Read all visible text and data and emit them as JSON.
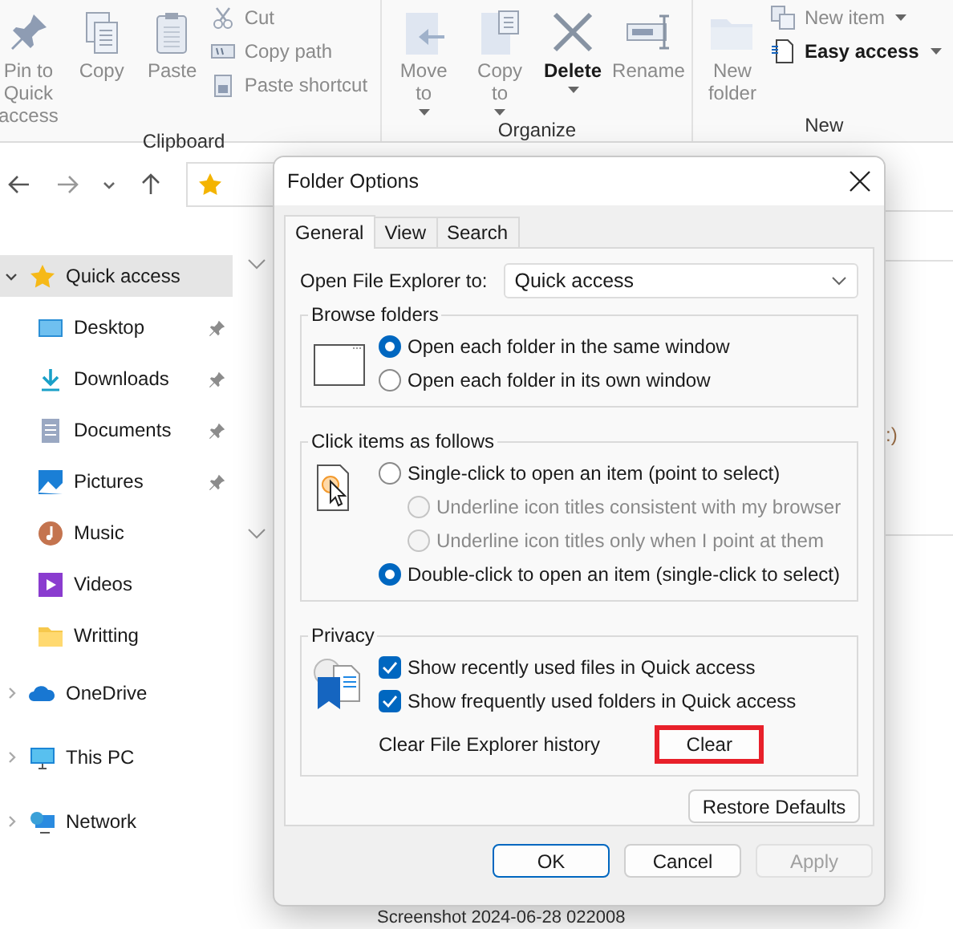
{
  "ribbon": {
    "groups": [
      {
        "label": "Clipboard",
        "items": [
          {
            "kind": "large",
            "label": "Pin to Quick access",
            "disabled": true,
            "dropdown": false
          },
          {
            "kind": "large",
            "label": "Copy",
            "disabled": true,
            "dropdown": false
          },
          {
            "kind": "large",
            "label": "Paste",
            "disabled": true,
            "dropdown": false
          },
          {
            "kind": "small",
            "label": "Cut",
            "disabled": true,
            "dropdown": false
          },
          {
            "kind": "small",
            "label": "Copy path",
            "disabled": true,
            "dropdown": false
          },
          {
            "kind": "small",
            "label": "Paste shortcut",
            "disabled": true,
            "dropdown": false
          }
        ]
      },
      {
        "label": "Organize",
        "items": [
          {
            "kind": "large",
            "label": "Move to",
            "disabled": true,
            "dropdown": true
          },
          {
            "kind": "large",
            "label": "Copy to",
            "disabled": true,
            "dropdown": true
          },
          {
            "kind": "large",
            "label": "Delete",
            "disabled": false,
            "dropdown": true
          },
          {
            "kind": "large",
            "label": "Rename",
            "disabled": true,
            "dropdown": false
          }
        ]
      },
      {
        "label": "New",
        "items": [
          {
            "kind": "large",
            "label": "New folder",
            "disabled": true,
            "dropdown": false
          },
          {
            "kind": "small",
            "label": "New item",
            "disabled": true,
            "dropdown": true
          },
          {
            "kind": "small",
            "label": "Easy access",
            "disabled": false,
            "dropdown": true
          }
        ]
      }
    ]
  },
  "sidebar": {
    "items": [
      {
        "label": "Quick access",
        "selected": true,
        "expanded": true,
        "children": [
          {
            "label": "Desktop",
            "pinned": true
          },
          {
            "label": "Downloads",
            "pinned": true
          },
          {
            "label": "Documents",
            "pinned": true
          },
          {
            "label": "Pictures",
            "pinned": true
          },
          {
            "label": "Music",
            "pinned": false
          },
          {
            "label": "Videos",
            "pinned": false
          },
          {
            "label": "Writting",
            "pinned": false
          }
        ]
      },
      {
        "label": "OneDrive",
        "selected": false,
        "expanded": false
      },
      {
        "label": "This PC",
        "selected": false,
        "expanded": false
      },
      {
        "label": "Network",
        "selected": false,
        "expanded": false
      }
    ]
  },
  "content": {
    "fragment": ":)",
    "last_file": "Screenshot 2024-06-28 022008"
  },
  "dialog": {
    "title": "Folder Options",
    "tabs": [
      {
        "label": "General",
        "selected": true
      },
      {
        "label": "View",
        "selected": false
      },
      {
        "label": "Search",
        "selected": false
      }
    ],
    "open_to": {
      "label": "Open File Explorer to:",
      "value": "Quick access"
    },
    "browse_folders": {
      "title": "Browse folders",
      "options": [
        {
          "label": "Open each folder in the same window",
          "selected": true
        },
        {
          "label": "Open each folder in its own window",
          "selected": false
        }
      ]
    },
    "click_items": {
      "title": "Click items as follows",
      "options": [
        {
          "label": "Single-click to open an item (point to select)",
          "selected": false,
          "children": [
            {
              "label": "Underline icon titles consistent with my browser",
              "selected": false,
              "disabled": true
            },
            {
              "label": "Underline icon titles only when I point at them",
              "selected": false,
              "disabled": true
            }
          ]
        },
        {
          "label": "Double-click to open an item (single-click to select)",
          "selected": true
        }
      ]
    },
    "privacy": {
      "title": "Privacy",
      "checkboxes": [
        {
          "label": "Show recently used files in Quick access",
          "checked": true
        },
        {
          "label": "Show frequently used folders in Quick access",
          "checked": true
        }
      ],
      "clear_label": "Clear File Explorer history",
      "clear_button": {
        "label": "Clear",
        "highlighted": true
      }
    },
    "restore_button": "Restore Defaults",
    "buttons": [
      {
        "label": "OK",
        "default": true,
        "disabled": false
      },
      {
        "label": "Cancel",
        "default": false,
        "disabled": false
      },
      {
        "label": "Apply",
        "default": false,
        "disabled": true
      }
    ]
  }
}
